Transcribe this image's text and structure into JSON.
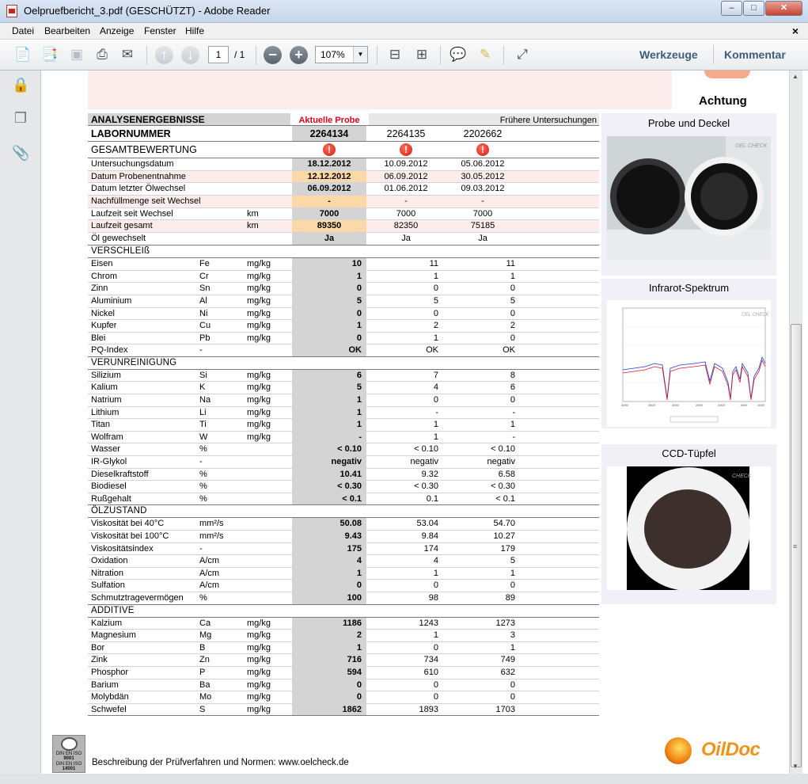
{
  "window": {
    "title": "Oelpruefbericht_3.pdf (GESCHÜTZT) - Adobe Reader",
    "minimize": "–",
    "maximize": "□",
    "close": "✕"
  },
  "menu": {
    "items": [
      "Datei",
      "Bearbeiten",
      "Anzeige",
      "Fenster",
      "Hilfe"
    ],
    "close_doc": "×"
  },
  "toolbar": {
    "page_current": "1",
    "page_total": "/ 1",
    "zoom": "107%",
    "werkzeuge": "Werkzeuge",
    "kommentar": "Kommentar"
  },
  "report": {
    "achtung": "Achtung",
    "header": {
      "analysenergebnisse": "ANALYSENERGEBNISSE",
      "aktuelle_probe": "Aktuelle Probe",
      "fruehere": "Frühere Untersuchungen",
      "labornummer_label": "LABORNUMMER",
      "labornummer": [
        "2264134",
        "2264135",
        "2202662"
      ],
      "gesamtbewertung": "GESAMTBEWERTUNG",
      "bewertung_mark": "!"
    },
    "info_rows": [
      {
        "name": "Untersuchungsdatum",
        "unit": "",
        "cur": "18.12.2012",
        "p1": "10.09.2012",
        "p2": "05.06.2012",
        "pink": false,
        "orange": false
      },
      {
        "name": "Datum Probenentnahme",
        "unit": "",
        "cur": "12.12.2012",
        "p1": "06.09.2012",
        "p2": "30.05.2012",
        "pink": true,
        "orange": true
      },
      {
        "name": "Datum letzter Ölwechsel",
        "unit": "",
        "cur": "06.09.2012",
        "p1": "01.06.2012",
        "p2": "09.03.2012",
        "pink": false,
        "orange": false
      },
      {
        "name": "Nachfüllmenge seit Wechsel",
        "unit": "",
        "cur": "-",
        "p1": "-",
        "p2": "-",
        "pink": true,
        "orange": true
      },
      {
        "name": "Laufzeit seit Wechsel",
        "unit": "km",
        "cur": "7000",
        "p1": "7000",
        "p2": "7000",
        "pink": false,
        "orange": false
      },
      {
        "name": "Laufzeit gesamt",
        "unit": "km",
        "cur": "89350",
        "p1": "82350",
        "p2": "75185",
        "pink": true,
        "orange": true
      },
      {
        "name": "Öl gewechselt",
        "unit": "",
        "cur": "Ja",
        "p1": "Ja",
        "p2": "Ja",
        "pink": false,
        "orange": false
      }
    ],
    "sections": [
      {
        "title": "VERSCHLEIß",
        "rows": [
          {
            "name": "Eisen",
            "sym": "Fe",
            "unit": "mg/kg",
            "cur": "10",
            "p1": "11",
            "p2": "11"
          },
          {
            "name": "Chrom",
            "sym": "Cr",
            "unit": "mg/kg",
            "cur": "1",
            "p1": "1",
            "p2": "1"
          },
          {
            "name": "Zinn",
            "sym": "Sn",
            "unit": "mg/kg",
            "cur": "0",
            "p1": "0",
            "p2": "0"
          },
          {
            "name": "Aluminium",
            "sym": "Al",
            "unit": "mg/kg",
            "cur": "5",
            "p1": "5",
            "p2": "5"
          },
          {
            "name": "Nickel",
            "sym": "Ni",
            "unit": "mg/kg",
            "cur": "0",
            "p1": "0",
            "p2": "0"
          },
          {
            "name": "Kupfer",
            "sym": "Cu",
            "unit": "mg/kg",
            "cur": "1",
            "p1": "2",
            "p2": "2"
          },
          {
            "name": "Blei",
            "sym": "Pb",
            "unit": "mg/kg",
            "cur": "0",
            "p1": "1",
            "p2": "0"
          },
          {
            "name": "PQ-Index",
            "sym": "-",
            "unit": "",
            "cur": "OK",
            "p1": "OK",
            "p2": "OK"
          }
        ]
      },
      {
        "title": "VERUNREINIGUNG",
        "rows": [
          {
            "name": "Silizium",
            "sym": "Si",
            "unit": "mg/kg",
            "cur": "6",
            "p1": "7",
            "p2": "8"
          },
          {
            "name": "Kalium",
            "sym": "K",
            "unit": "mg/kg",
            "cur": "5",
            "p1": "4",
            "p2": "6"
          },
          {
            "name": "Natrium",
            "sym": "Na",
            "unit": "mg/kg",
            "cur": "1",
            "p1": "0",
            "p2": "0"
          },
          {
            "name": "Lithium",
            "sym": "Li",
            "unit": "mg/kg",
            "cur": "1",
            "p1": "-",
            "p2": "-"
          },
          {
            "name": "Titan",
            "sym": "Ti",
            "unit": "mg/kg",
            "cur": "1",
            "p1": "1",
            "p2": "1"
          },
          {
            "name": "Wolfram",
            "sym": "W",
            "unit": "mg/kg",
            "cur": "-",
            "p1": "1",
            "p2": "-"
          },
          {
            "name": "Wasser",
            "sym": "%",
            "unit": "",
            "cur": "< 0.10",
            "p1": "< 0.10",
            "p2": "< 0.10"
          },
          {
            "name": "IR-Glykol",
            "sym": "-",
            "unit": "",
            "cur": "negativ",
            "p1": "negativ",
            "p2": "negativ"
          },
          {
            "name": "Dieselkraftstoff",
            "sym": "%",
            "unit": "",
            "cur": "10.41",
            "p1": "9.32",
            "p2": "6.58"
          },
          {
            "name": "Biodiesel",
            "sym": "%",
            "unit": "",
            "cur": "< 0.30",
            "p1": "< 0.30",
            "p2": "< 0.30"
          },
          {
            "name": "Rußgehalt",
            "sym": "%",
            "unit": "",
            "cur": "< 0.1",
            "p1": "0.1",
            "p2": "< 0.1"
          }
        ]
      },
      {
        "title": "ÖLZUSTAND",
        "rows": [
          {
            "name": "Viskosität bei 40°C",
            "sym": "mm²/s",
            "unit": "",
            "cur": "50.08",
            "p1": "53.04",
            "p2": "54.70"
          },
          {
            "name": "Viskosität bei 100°C",
            "sym": "mm²/s",
            "unit": "",
            "cur": "9.43",
            "p1": "9.84",
            "p2": "10.27"
          },
          {
            "name": "Viskositätsindex",
            "sym": "-",
            "unit": "",
            "cur": "175",
            "p1": "174",
            "p2": "179"
          },
          {
            "name": "Oxidation",
            "sym": "A/cm",
            "unit": "",
            "cur": "4",
            "p1": "4",
            "p2": "5"
          },
          {
            "name": "Nitration",
            "sym": "A/cm",
            "unit": "",
            "cur": "1",
            "p1": "1",
            "p2": "1"
          },
          {
            "name": "Sulfation",
            "sym": "A/cm",
            "unit": "",
            "cur": "0",
            "p1": "0",
            "p2": "0"
          },
          {
            "name": "Schmutztragevermögen",
            "sym": "%",
            "unit": "",
            "cur": "100",
            "p1": "98",
            "p2": "89"
          }
        ]
      },
      {
        "title": "ADDITIVE",
        "rows": [
          {
            "name": "Kalzium",
            "sym": "Ca",
            "unit": "mg/kg",
            "cur": "1186",
            "p1": "1243",
            "p2": "1273"
          },
          {
            "name": "Magnesium",
            "sym": "Mg",
            "unit": "mg/kg",
            "cur": "2",
            "p1": "1",
            "p2": "3"
          },
          {
            "name": "Bor",
            "sym": "B",
            "unit": "mg/kg",
            "cur": "1",
            "p1": "0",
            "p2": "1"
          },
          {
            "name": "Zink",
            "sym": "Zn",
            "unit": "mg/kg",
            "cur": "716",
            "p1": "734",
            "p2": "749"
          },
          {
            "name": "Phosphor",
            "sym": "P",
            "unit": "mg/kg",
            "cur": "594",
            "p1": "610",
            "p2": "632"
          },
          {
            "name": "Barium",
            "sym": "Ba",
            "unit": "mg/kg",
            "cur": "0",
            "p1": "0",
            "p2": "0"
          },
          {
            "name": "Molybdän",
            "sym": "Mo",
            "unit": "mg/kg",
            "cur": "0",
            "p1": "0",
            "p2": "0"
          },
          {
            "name": "Schwefel",
            "sym": "S",
            "unit": "mg/kg",
            "cur": "1862",
            "p1": "1893",
            "p2": "1703"
          }
        ]
      }
    ],
    "side": {
      "probe_title": "Probe und Deckel",
      "ir_title": "Infrarot-Spektrum",
      "ccd_title": "CCD-Tüpfel"
    },
    "footer": {
      "text": "Beschreibung der Prüfverfahren und Normen: www.oelcheck.de",
      "cert_lines": [
        "DIN EN ISO",
        "9001",
        "DIN EN ISO",
        "14001"
      ],
      "logo": "OilDoc"
    }
  }
}
